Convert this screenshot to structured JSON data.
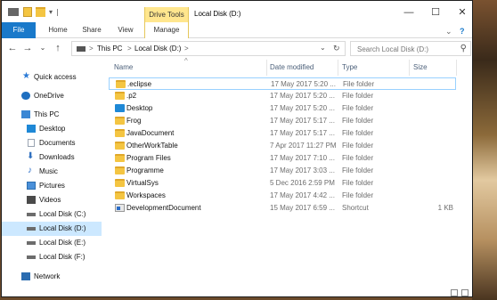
{
  "window": {
    "title": "Local Disk (D:)",
    "context_tab": "Drive Tools",
    "controls": {
      "minimize": "—",
      "maximize": "☐",
      "close": "✕"
    }
  },
  "ribbon": {
    "tabs": [
      "File",
      "Home",
      "Share",
      "View",
      "Manage"
    ]
  },
  "address": {
    "crumbs": [
      "This PC",
      "Local Disk (D:)"
    ],
    "separator": ">",
    "search_placeholder": "Search Local Disk (D:)"
  },
  "nav": {
    "items": [
      {
        "label": "Quick access",
        "icon": "star-icon",
        "color": "#2a7ad6"
      },
      {
        "label": "OneDrive",
        "icon": "cloud-icon",
        "color": "#1f6fc0"
      },
      {
        "label": "This PC",
        "icon": "computer-icon",
        "color": "#3b87d4"
      },
      {
        "label": "Desktop",
        "icon": "desktop-icon",
        "color": "#1e88d6"
      },
      {
        "label": "Documents",
        "icon": "documents-icon",
        "color": "#9aa4b2"
      },
      {
        "label": "Downloads",
        "icon": "downloads-icon",
        "color": "#2e6fbf"
      },
      {
        "label": "Music",
        "icon": "music-icon",
        "color": "#2a6dc8"
      },
      {
        "label": "Pictures",
        "icon": "pictures-icon",
        "color": "#4a90d9"
      },
      {
        "label": "Videos",
        "icon": "videos-icon",
        "color": "#4a4a4a"
      },
      {
        "label": "Local Disk (C:)",
        "icon": "drive-icon",
        "color": "#6c6c6c"
      },
      {
        "label": "Local Disk (D:)",
        "icon": "drive-icon",
        "color": "#6c6c6c",
        "selected": true
      },
      {
        "label": "Local Disk (E:)",
        "icon": "drive-icon",
        "color": "#6c6c6c"
      },
      {
        "label": "Local Disk (F:)",
        "icon": "drive-icon",
        "color": "#6c6c6c"
      },
      {
        "label": "Network",
        "icon": "network-icon",
        "color": "#2b6cb0"
      }
    ]
  },
  "columns": {
    "name": "Name",
    "date": "Date modified",
    "type": "Type",
    "size": "Size"
  },
  "files": [
    {
      "name": ".eclipse",
      "date": "17 May 2017 5:20 ...",
      "type": "File folder",
      "size": "",
      "icon": "folder-icon"
    },
    {
      "name": ".p2",
      "date": "17 May 2017 5:20 ...",
      "type": "File folder",
      "size": "",
      "icon": "folder-icon"
    },
    {
      "name": "Desktop",
      "date": "17 May 2017 5:20 ...",
      "type": "File folder",
      "size": "",
      "icon": "desktop-folder-icon"
    },
    {
      "name": "Frog",
      "date": "17 May 2017 5:17 ...",
      "type": "File folder",
      "size": "",
      "icon": "folder-icon"
    },
    {
      "name": "JavaDocument",
      "date": "17 May 2017 5:17 ...",
      "type": "File folder",
      "size": "",
      "icon": "folder-icon"
    },
    {
      "name": "OtherWorkTable",
      "date": "7 Apr 2017 11:27 PM",
      "type": "File folder",
      "size": "",
      "icon": "folder-icon"
    },
    {
      "name": "Program Files",
      "date": "17 May 2017 7:10 ...",
      "type": "File folder",
      "size": "",
      "icon": "folder-icon"
    },
    {
      "name": "Programme",
      "date": "17 May 2017 3:03 ...",
      "type": "File folder",
      "size": "",
      "icon": "folder-icon"
    },
    {
      "name": "VirtualSys",
      "date": "5 Dec 2016 2:59 PM",
      "type": "File folder",
      "size": "",
      "icon": "folder-icon"
    },
    {
      "name": "Workspaces",
      "date": "17 May 2017 4:42 ...",
      "type": "File folder",
      "size": "",
      "icon": "folder-icon"
    },
    {
      "name": "DevelopmentDocument",
      "date": "15 May 2017 6:59 ...",
      "type": "Shortcut",
      "size": "1 KB",
      "icon": "shortcut-icon"
    }
  ]
}
